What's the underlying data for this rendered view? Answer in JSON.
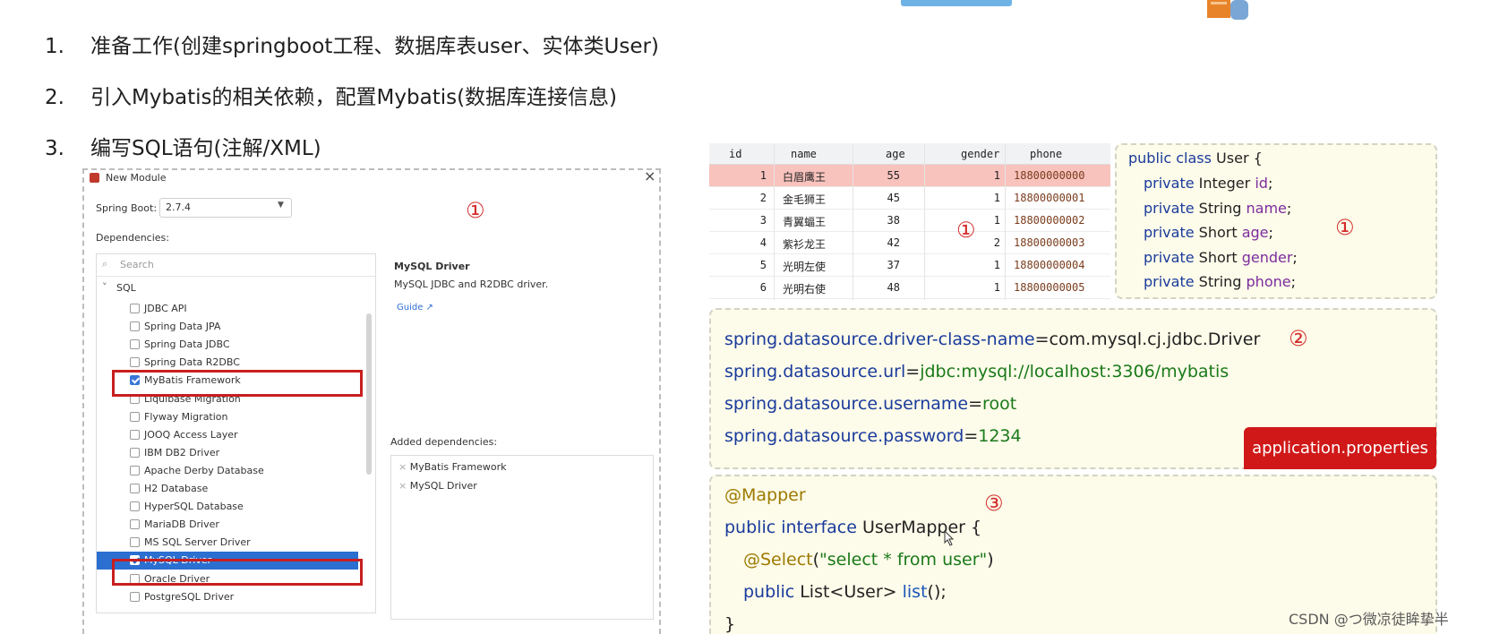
{
  "steps": [
    {
      "num": "1.",
      "text": "准备工作(创建springboot工程、数据库表user、实体类User)"
    },
    {
      "num": "2.",
      "text": "引入Mybatis的相关依赖，配置Mybatis(数据库连接信息)"
    },
    {
      "num": "3.",
      "text": "编写SQL语句(注解/XML)"
    }
  ],
  "dialog": {
    "title": "New Module",
    "close": "×",
    "spring_boot_label": "Spring Boot:",
    "spring_boot_value": "2.7.4",
    "dependencies_label": "Dependencies:",
    "search_placeholder": "Search",
    "group": "SQL",
    "items": [
      {
        "label": "JDBC API",
        "checked": false
      },
      {
        "label": "Spring Data JPA",
        "checked": false
      },
      {
        "label": "Spring Data JDBC",
        "checked": false
      },
      {
        "label": "Spring Data R2DBC",
        "checked": false
      },
      {
        "label": "MyBatis Framework",
        "checked": true
      },
      {
        "label": "Liquibase Migration",
        "checked": false
      },
      {
        "label": "Flyway Migration",
        "checked": false
      },
      {
        "label": "JOOQ Access Layer",
        "checked": false
      },
      {
        "label": "IBM DB2 Driver",
        "checked": false
      },
      {
        "label": "Apache Derby Database",
        "checked": false
      },
      {
        "label": "H2 Database",
        "checked": false
      },
      {
        "label": "HyperSQL Database",
        "checked": false
      },
      {
        "label": "MariaDB Driver",
        "checked": false
      },
      {
        "label": "MS SQL Server Driver",
        "checked": false
      },
      {
        "label": "MySQL Driver",
        "checked": true
      },
      {
        "label": "Oracle Driver",
        "checked": false
      },
      {
        "label": "PostgreSQL Driver",
        "checked": false
      }
    ],
    "detail_title": "MySQL Driver",
    "detail_desc": "MySQL JDBC and R2DBC driver.",
    "detail_link": "Guide ↗",
    "added_label": "Added dependencies:",
    "added": [
      "MyBatis Framework",
      "MySQL Driver"
    ],
    "marker": "①"
  },
  "table": {
    "columns": [
      "id",
      "name",
      "age",
      "gender",
      "phone"
    ],
    "rows": [
      [
        "1",
        "白眉鹰王",
        "55",
        "1",
        "18800000000"
      ],
      [
        "2",
        "金毛狮王",
        "45",
        "1",
        "18800000001"
      ],
      [
        "3",
        "青翼蝠王",
        "38",
        "1",
        "18800000002"
      ],
      [
        "4",
        "紫衫龙王",
        "42",
        "2",
        "18800000003"
      ],
      [
        "5",
        "光明左使",
        "37",
        "1",
        "18800000004"
      ],
      [
        "6",
        "光明右使",
        "48",
        "1",
        "18800000005"
      ]
    ],
    "marker": "①"
  },
  "entity": {
    "class_kw": "public class",
    "class_name": "User {",
    "fields": [
      {
        "mod": "private",
        "type": "Integer",
        "name": "id",
        "end": ";"
      },
      {
        "mod": "private",
        "type": "String",
        "name": "name",
        "end": ";"
      },
      {
        "mod": "private",
        "type": "Short",
        "name": "age",
        "end": ";"
      },
      {
        "mod": "private",
        "type": "Short",
        "name": "gender",
        "end": ";"
      },
      {
        "mod": "private",
        "type": "String",
        "name": "phone",
        "end": ";"
      }
    ],
    "marker": "①"
  },
  "props": {
    "lines": [
      {
        "key": "spring.datasource.driver-class-name",
        "eq": "=",
        "val": "com.mysql.cj.jdbc.Driver"
      },
      {
        "key": "spring.datasource.url",
        "eq": "=",
        "val": "jdbc:mysql://localhost:3306/mybatis"
      },
      {
        "key": "spring.datasource.username",
        "eq": "=",
        "val": "root"
      },
      {
        "key": "spring.datasource.password",
        "eq": "=",
        "val": "1234"
      }
    ],
    "file_badge": "application.properties",
    "marker": "②"
  },
  "mapper": {
    "annotation": "@Mapper",
    "decl_kw": "public interface",
    "decl_name": "UserMapper {",
    "select_ann": "@Select",
    "select_open": "(",
    "select_str": "\"select * from user\"",
    "select_close": ")",
    "method_kw": "public",
    "method_type": "List<User>",
    "method_name": "list",
    "method_end": "();",
    "close": "}",
    "marker": "③"
  },
  "watermark": "CSDN @つ微凉徒眸挚半",
  "colors": {
    "accent_red": "#d01818",
    "keyword_blue": "#1a3b9c",
    "panel_bg": "#fdfbe9",
    "selected_row": "#f8c2bd"
  }
}
